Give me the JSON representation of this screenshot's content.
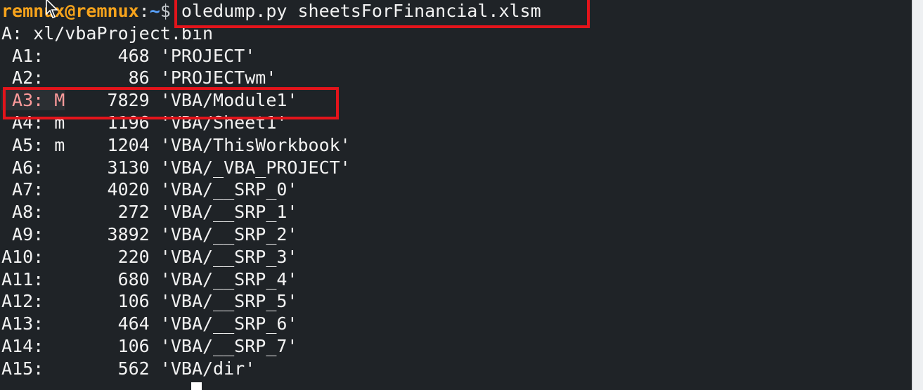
{
  "prompt": {
    "user": "remnux@remnux",
    "sep": ":",
    "path": "~",
    "symbol": "$",
    "command": " oledump.py sheetsForFinancial.xlsm"
  },
  "container_line": "A: xl/vbaProject.bin",
  "streams": [
    {
      "index": " A1:",
      "mark": "  ",
      "size": "     468",
      "name": " 'PROJECT'"
    },
    {
      "index": " A2:",
      "mark": "  ",
      "size": "      86",
      "name": " 'PROJECTwm'"
    },
    {
      "index": " A3:",
      "mark": " M",
      "size": "    7829",
      "name": " 'VBA/Module1'"
    },
    {
      "index": " A4:",
      "mark": " m",
      "size": "    1196",
      "name": " 'VBA/Sheet1'"
    },
    {
      "index": " A5:",
      "mark": " m",
      "size": "    1204",
      "name": " 'VBA/ThisWorkbook'"
    },
    {
      "index": " A6:",
      "mark": "  ",
      "size": "    3130",
      "name": " 'VBA/_VBA_PROJECT'"
    },
    {
      "index": " A7:",
      "mark": "  ",
      "size": "    4020",
      "name": " 'VBA/__SRP_0'"
    },
    {
      "index": " A8:",
      "mark": "  ",
      "size": "     272",
      "name": " 'VBA/__SRP_1'"
    },
    {
      "index": " A9:",
      "mark": "  ",
      "size": "    3892",
      "name": " 'VBA/__SRP_2'"
    },
    {
      "index": "A10:",
      "mark": "  ",
      "size": "     220",
      "name": " 'VBA/__SRP_3'"
    },
    {
      "index": "A11:",
      "mark": "  ",
      "size": "     680",
      "name": " 'VBA/__SRP_4'"
    },
    {
      "index": "A12:",
      "mark": "  ",
      "size": "     106",
      "name": " 'VBA/__SRP_5'"
    },
    {
      "index": "A13:",
      "mark": "  ",
      "size": "     464",
      "name": " 'VBA/__SRP_6'"
    },
    {
      "index": "A14:",
      "mark": "  ",
      "size": "     106",
      "name": " 'VBA/__SRP_7'"
    },
    {
      "index": "A15:",
      "mark": "  ",
      "size": "     562",
      "name": " 'VBA/dir'"
    }
  ],
  "colors": {
    "background": "#1f2327",
    "prompt_user": "#f6a31c",
    "prompt_path": "#5aa3ff",
    "highlight_box": "#e3141b"
  },
  "icons": {
    "pointer": "mouse-pointer-icon"
  }
}
